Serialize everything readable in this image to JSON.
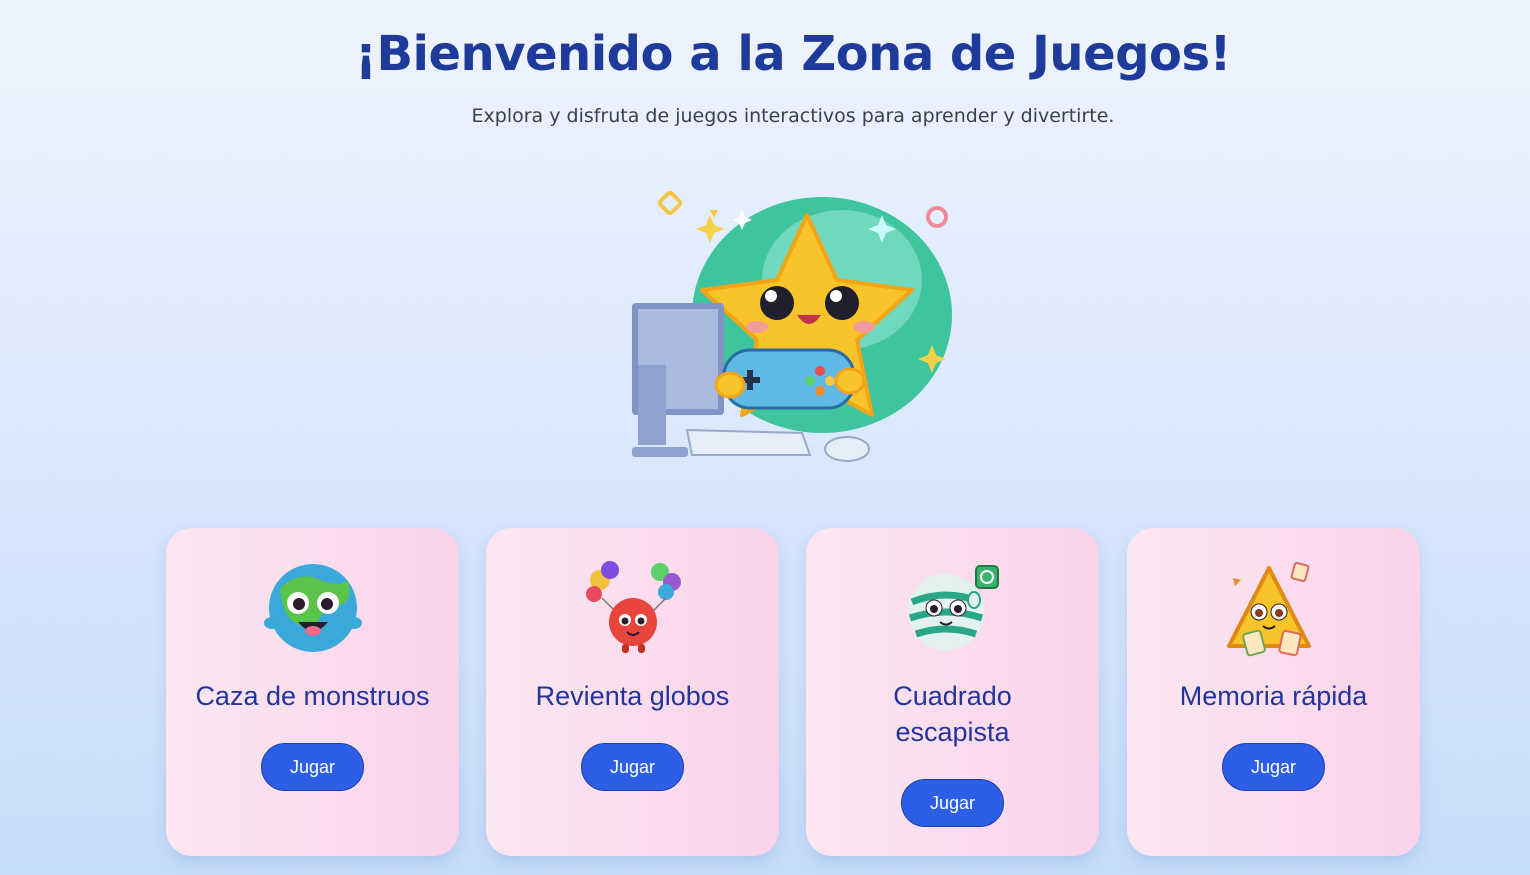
{
  "header": {
    "title": "¡Bienvenido a la Zona de Juegos!",
    "subtitle": "Explora y disfruta de juegos interactivos para aprender y divertirte."
  },
  "hero": {
    "icon": "star-gamer-mascot"
  },
  "games": [
    {
      "title": "Caza de monstruos",
      "button_label": "Jugar",
      "icon": "monster-icon"
    },
    {
      "title": "Revienta globos",
      "button_label": "Jugar",
      "icon": "balloon-icon"
    },
    {
      "title": "Cuadrado escapista",
      "button_label": "Jugar",
      "icon": "ball-icon"
    },
    {
      "title": "Memoria rápida",
      "button_label": "Jugar",
      "icon": "triangle-cards-icon"
    }
  ],
  "colors": {
    "title": "#1e3a9a",
    "card_title": "#23359a",
    "button": "#2c5fe6",
    "card_bg": "#f9d3ea"
  }
}
